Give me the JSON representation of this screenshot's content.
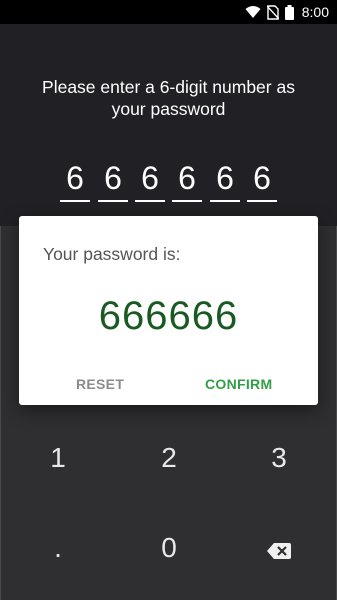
{
  "status_bar": {
    "time": "8:00",
    "icons": [
      "wifi-icon",
      "no-sim-icon",
      "battery-icon"
    ]
  },
  "prompt": {
    "line1": "Please enter a 6-digit number as",
    "line2": "your password"
  },
  "entered_digits": [
    "6",
    "6",
    "6",
    "6",
    "6",
    "6"
  ],
  "dialog": {
    "title": "Your password is:",
    "value": "666666",
    "reset_label": "RESET",
    "confirm_label": "CONFIRM"
  },
  "keypad": {
    "keys": [
      "1",
      "2",
      "3",
      ".",
      "0"
    ],
    "backspace_icon": "backspace-icon"
  },
  "colors": {
    "background": "#212024",
    "keypad": "#2f2f31",
    "accent": "#2f9e47",
    "password_text": "#1a5a22"
  }
}
